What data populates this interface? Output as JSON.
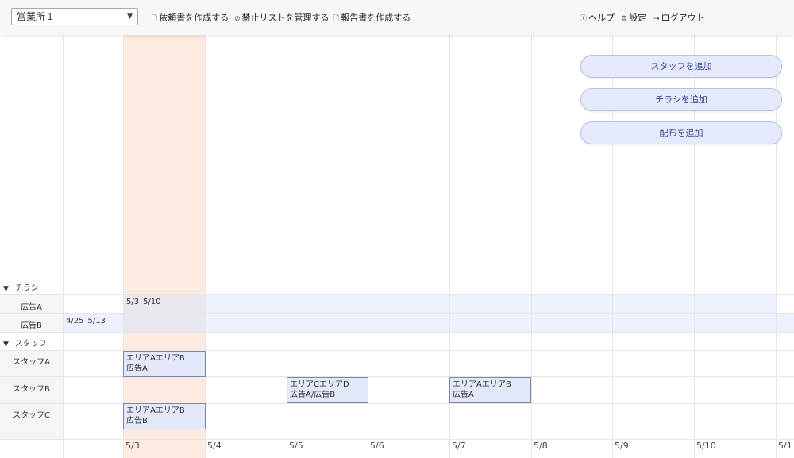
{
  "toolbar": {
    "office": "営業所１",
    "create_request": "依頼書を作成する",
    "manage_blacklist": "禁止リストを管理する",
    "create_report": "報告書を作成する",
    "help": "ヘルプ",
    "settings": "設定",
    "logout": "ログアウト"
  },
  "actions": {
    "add_staff": "スタッフを追加",
    "add_flyer": "チラシを追加",
    "add_distribution": "配布を追加"
  },
  "groups": {
    "flyers": "チラシ",
    "staff": "スタッフ"
  },
  "flyers": [
    {
      "label": "広告A",
      "period": "5/3–5/10"
    },
    {
      "label": "広告B",
      "period": "4/25–5/13"
    }
  ],
  "staff": [
    {
      "label": "スタッフA"
    },
    {
      "label": "スタッフB"
    },
    {
      "label": "スタッフC"
    }
  ],
  "assignments": [
    {
      "areas": "エリアAエリアB",
      "ads": "広告A"
    },
    {
      "areas": "エリアCエリアD",
      "ads": "広告A/広告B"
    },
    {
      "areas": "エリアAエリアB",
      "ads": "広告A"
    },
    {
      "areas": "エリアAエリアB",
      "ads": "広告B"
    }
  ],
  "dates": [
    "5/3",
    "5/4",
    "5/5",
    "5/6",
    "5/7",
    "5/8",
    "5/9",
    "5/10",
    "5/1"
  ],
  "colors": {
    "today_highlight": "#fdebe1",
    "band": "#eef2fe",
    "card": "#e3e8f9",
    "button": "#e4e9fb"
  }
}
